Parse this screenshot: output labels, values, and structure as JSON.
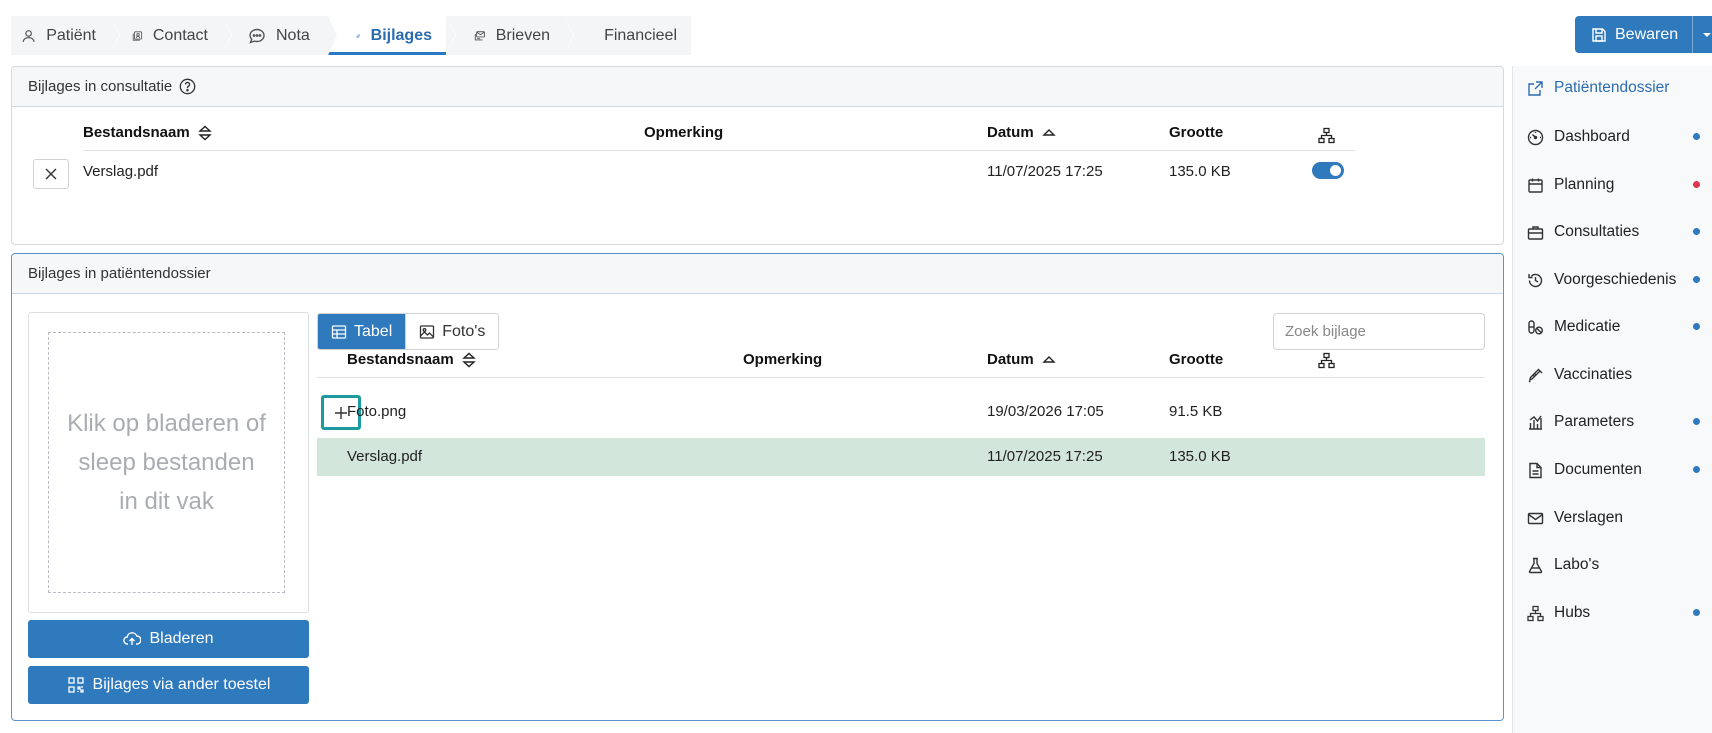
{
  "tabs": [
    {
      "label": "Patiënt",
      "icon": "person-icon"
    },
    {
      "label": "Contact",
      "icon": "contact-card-icon"
    },
    {
      "label": "Nota",
      "icon": "chat-bubble-icon"
    },
    {
      "label": "Bijlages",
      "icon": "paperclip-icon",
      "active": true
    },
    {
      "label": "Brieven",
      "icon": "envelopes-icon"
    },
    {
      "label": "Financieel",
      "icon": "euro-icon"
    }
  ],
  "toolbar": {
    "save_label": "Bewaren"
  },
  "consultatie": {
    "title": "Bijlages in consultatie",
    "columns": {
      "filename": "Bestandsnaam",
      "remark": "Opmerking",
      "date": "Datum",
      "size": "Grootte"
    },
    "rows": [
      {
        "filename": "Verslag.pdf",
        "remark": "",
        "date": "11/07/2025 17:25",
        "size": "135.0 KB",
        "linked": true
      }
    ]
  },
  "dossier": {
    "title": "Bijlages in patiëntendossier",
    "dropzone_text": "Klik op bladeren of sleep bestanden in dit vak",
    "browse_label": "Bladeren",
    "other_device_label": "Bijlages via ander toestel",
    "view_table_label": "Tabel",
    "view_photos_label": "Foto's",
    "search_placeholder": "Zoek bijlage",
    "columns": {
      "filename": "Bestandsnaam",
      "remark": "Opmerking",
      "date": "Datum",
      "size": "Grootte"
    },
    "rows": [
      {
        "filename": "Foto.png",
        "remark": "",
        "date": "19/03/2026 17:05",
        "size": "91.5 KB"
      },
      {
        "filename": "Verslag.pdf",
        "remark": "",
        "date": "11/07/2025 17:25",
        "size": "135.0 KB",
        "highlighted": true
      }
    ]
  },
  "sidenav": {
    "items": [
      {
        "label": "Patiëntendossier",
        "icon": "external-link-icon",
        "dot": null
      },
      {
        "label": "Dashboard",
        "icon": "gauge-icon",
        "dot": "#2f79bd"
      },
      {
        "label": "Planning",
        "icon": "calendar-icon",
        "dot": "#e0364b"
      },
      {
        "label": "Consultaties",
        "icon": "briefcase-icon",
        "dot": "#2f79bd"
      },
      {
        "label": "Voorgeschiedenis",
        "icon": "history-icon",
        "dot": "#2f79bd"
      },
      {
        "label": "Medicatie",
        "icon": "pills-icon",
        "dot": "#2f79bd"
      },
      {
        "label": "Vaccinaties",
        "icon": "syringe-icon",
        "dot": null
      },
      {
        "label": "Parameters",
        "icon": "chart-icon",
        "dot": "#2f79bd"
      },
      {
        "label": "Documenten",
        "icon": "document-icon",
        "dot": "#2f79bd"
      },
      {
        "label": "Verslagen",
        "icon": "envelope-icon",
        "dot": null
      },
      {
        "label": "Labo's",
        "icon": "flask-icon",
        "dot": null
      },
      {
        "label": "Hubs",
        "icon": "hubs-network-icon",
        "dot": "#2f79bd"
      }
    ]
  },
  "colors": {
    "primary": "#2f79bd",
    "highlight_row": "#d2e6dc",
    "focus_ring": "#1b9ba0",
    "alert_dot": "#e0364b"
  }
}
